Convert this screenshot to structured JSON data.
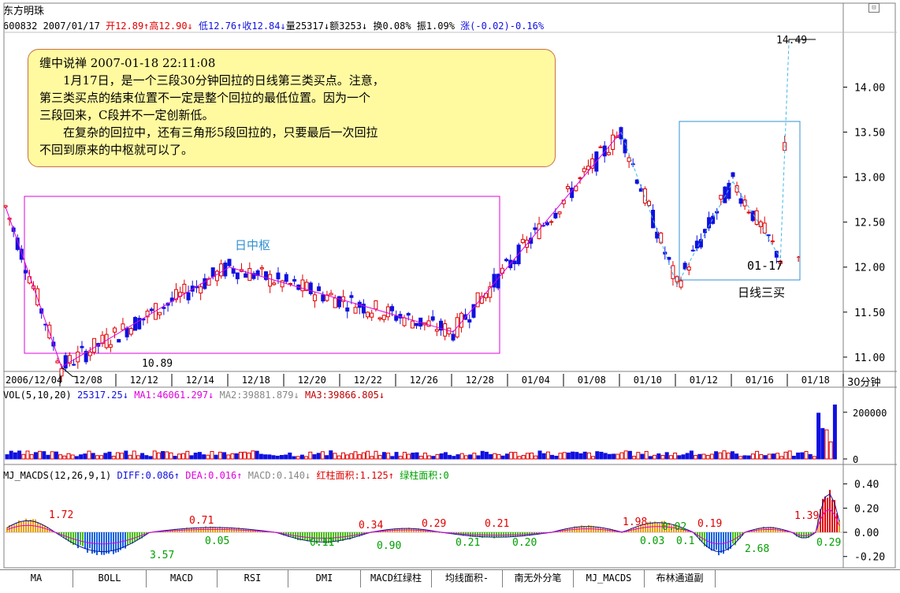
{
  "window": {
    "title": "东方明珠",
    "corner_icon": "restore-icon"
  },
  "quote": {
    "code_date": "600832 2007/01/17",
    "open": "开12.89↑",
    "high": "高12.90↓",
    "low": "低12.76↑",
    "close": "收12.84↓",
    "volume": "量25317↓",
    "amount": "额3253↓",
    "turnover": "换0.08%",
    "amplitude": "振1.09%",
    "change": "涨(-0.02)-0.16%"
  },
  "note": {
    "title": "缠中说禅 2007-01-18 22:11:08",
    "lines": [
      "1月17日，是一个三段30分钟回拉的日线第三类买点。注意，",
      "第三类买点的结束位置不一定是整个回拉的最低位置。因为一个",
      "三段回来，C段并不一定创新低。",
      "在复杂的回拉中，还有三角形5段回拉的，只要最后一次回拉",
      "不回到原来的中枢就可以了。"
    ]
  },
  "annotations": {
    "zhongshu": "日中枢",
    "low_label": "10.89",
    "high_label": "14.49",
    "buy_date": "01-17",
    "buy_label": "日线三买"
  },
  "period_label": "30分钟",
  "vol_header": {
    "name": "VOL(5,10,20)",
    "value": "25317.25↓",
    "ma1": "MA1:46061.297↓",
    "ma2": "MA2:39881.879↓",
    "ma3": "MA3:39866.805↓"
  },
  "macd_header": {
    "name": "MJ_MACDS(12,26,9,1)",
    "diff": "DIFF:0.086↑",
    "dea": "DEA:0.016↑",
    "macd": "MACD:0.140↓",
    "red_area": "红柱面积:1.125↑",
    "green_area": "绿柱面积:0"
  },
  "macd_area_labels": [
    "1.72",
    "3.57",
    "0.71",
    "0.05",
    "0.11",
    "0.34",
    "0.90",
    "0.29",
    "0.21",
    "0.21",
    "0.20",
    "1.98",
    "0.03",
    "0.02",
    "0.19",
    "0.1",
    "2.68",
    "1.39",
    "0.29"
  ],
  "tabs": [
    "MA",
    "BOLL",
    "MACD",
    "RSI",
    "DMI",
    "MACD红绿柱",
    "均线面积-",
    "南无外分笔",
    "MJ_MACDS",
    "布林通道副"
  ],
  "colors": {
    "up": "#e00000",
    "down": "#1010e0",
    "zhongshu": "#e000e0",
    "box": "#3090d0",
    "note_bg": "#fffaa0"
  },
  "chart_data": [
    {
      "type": "candlestick",
      "title": "",
      "x_tick_labels": [
        "2006/12/04",
        "12/08",
        "12/12",
        "12/14",
        "12/18",
        "12/20",
        "12/22",
        "12/26",
        "12/28",
        "01/04",
        "01/08",
        "01/10",
        "01/12",
        "01/16",
        "01/18"
      ],
      "y_tick_labels": [
        "11.00",
        "11.50",
        "12.00",
        "12.50",
        "13.00",
        "13.50",
        "14.00"
      ],
      "ylim": [
        10.85,
        14.6
      ],
      "path_points": [
        {
          "x": "2006/12/04",
          "y": 12.67
        },
        {
          "x": "12/08",
          "y": 10.89
        },
        {
          "x": "12/18",
          "y": 12.0
        },
        {
          "x": "12/28",
          "y": 11.28
        },
        {
          "x": "01/10",
          "y": 13.5
        },
        {
          "x": "01/12",
          "y": 11.8
        },
        {
          "x": "01/16",
          "y": 12.95
        },
        {
          "x": "01/17",
          "y": 12.1
        },
        {
          "x": "01/18",
          "y": 14.49
        }
      ],
      "annotations": [
        "日中枢",
        "10.89",
        "14.49",
        "01-17",
        "日线三买"
      ]
    },
    {
      "type": "bar",
      "title": "VOL(5,10,20)",
      "y_tick_labels": [
        "200000",
        "0"
      ],
      "ylim": [
        0,
        250000
      ],
      "last_value": 25317.25,
      "ma": {
        "MA1": 46061.297,
        "MA2": 39881.879,
        "MA3": 39866.805
      }
    },
    {
      "type": "bar",
      "title": "MJ_MACDS(12,26,9,1)",
      "y_tick_labels": [
        "0.40",
        "0.20",
        "0.00",
        "-0.20"
      ],
      "ylim": [
        -0.28,
        0.45
      ],
      "last": {
        "DIFF": 0.086,
        "DEA": 0.016,
        "MACD": 0.14
      }
    }
  ]
}
